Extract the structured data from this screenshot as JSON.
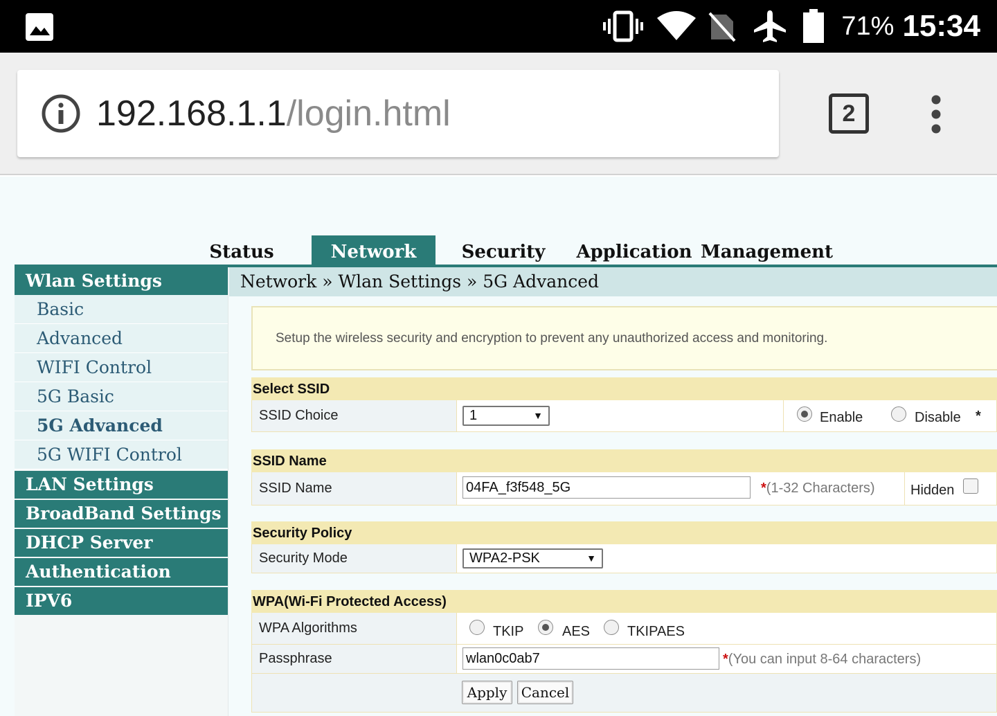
{
  "status_bar": {
    "battery_percent": "71%",
    "time": "15:34",
    "icons": [
      "gallery-icon",
      "vibrate-icon",
      "wifi-icon",
      "no-sim-icon",
      "airplane-icon",
      "battery-icon"
    ]
  },
  "browser": {
    "url_host": "192.168.1.1",
    "url_path": "/login.html",
    "tab_count": "2"
  },
  "topnav": {
    "items": [
      "Status",
      "Network",
      "Security",
      "Application",
      "Management"
    ],
    "active": "Network"
  },
  "sidebar": {
    "wlan_settings": "Wlan Settings",
    "wlan_items": [
      "Basic",
      "Advanced",
      "WIFI Control",
      "5G Basic",
      "5G Advanced",
      "5G WIFI Control"
    ],
    "current": "5G Advanced",
    "groups": [
      "LAN Settings",
      "BroadBand Settings",
      "DHCP Server",
      "Authentication",
      "IPV6"
    ]
  },
  "breadcrumb": "Network » Wlan Settings » 5G Advanced",
  "notice": "Setup the wireless security and encryption to prevent any unauthorized access and monitoring.",
  "select_ssid": {
    "title": "Select SSID",
    "label": "SSID Choice",
    "value": "1",
    "enable": "Enable",
    "disable": "Disable",
    "required": "*"
  },
  "ssid_name": {
    "title": "SSID Name",
    "label": "SSID Name",
    "value": "04FA_f3f548_5G",
    "hint_star": "*",
    "hint": "(1-32 Characters)",
    "hidden": "Hidden"
  },
  "security_policy": {
    "title": "Security Policy",
    "label": "Security Mode",
    "value": "WPA2-PSK"
  },
  "wpa": {
    "title": "WPA(Wi-Fi Protected Access)",
    "algorithms_label": "WPA Algorithms",
    "options": [
      "TKIP",
      "AES",
      "TKIPAES"
    ],
    "selected": "AES",
    "passphrase_label": "Passphrase",
    "passphrase": "wlan0c0ab7",
    "hint_star": "*",
    "hint": "(You can input 8-64 characters)"
  },
  "buttons": {
    "apply": "Apply",
    "cancel": "Cancel"
  },
  "colors": {
    "teal": "#2a7b77",
    "section": "#f3e9b3",
    "required": "#cc1111"
  }
}
